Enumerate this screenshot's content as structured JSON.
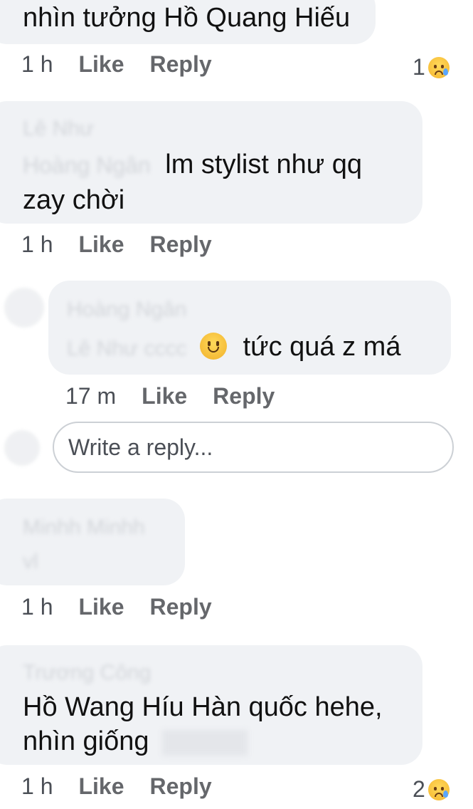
{
  "comments": [
    {
      "text": "nhìn tưởng Hồ Quang Hiếu",
      "time": "1 h",
      "like": "Like",
      "reply": "Reply",
      "reaction_count": "1",
      "reaction_icon": "crying-face-icon"
    },
    {
      "author_blurred": "Lê Như",
      "mention_blurred": "Hoàng Ngân",
      "text_line1": "lm stylist như qq",
      "text_line2": "zay chời",
      "time": "1 h",
      "like": "Like",
      "reply": "Reply"
    },
    {
      "author_blurred": "Hoàng Ngân",
      "mention_blurred": "Lê Như cccc",
      "emoji": "slightly-smiling-face-icon",
      "text": "tức quá z má",
      "time": "17 m",
      "like": "Like",
      "reply": "Reply"
    },
    {
      "author_blurred": "Minhh Minhh",
      "text_blurred": "vl",
      "time": "1 h",
      "like": "Like",
      "reply": "Reply"
    },
    {
      "author_blurred": "Trương Công",
      "text_line1": "Hồ Wang Híu Hàn quốc hehe,",
      "text_line2": "nhìn giống",
      "time": "1 h",
      "like": "Like",
      "reply": "Reply",
      "reaction_count": "2",
      "reaction_icon": "crying-face-icon"
    }
  ],
  "reply_box": {
    "placeholder": "Write a reply..."
  },
  "colors": {
    "bubble": "#f0f2f5",
    "meta_text": "#65676b",
    "border": "#ccd0d5"
  }
}
